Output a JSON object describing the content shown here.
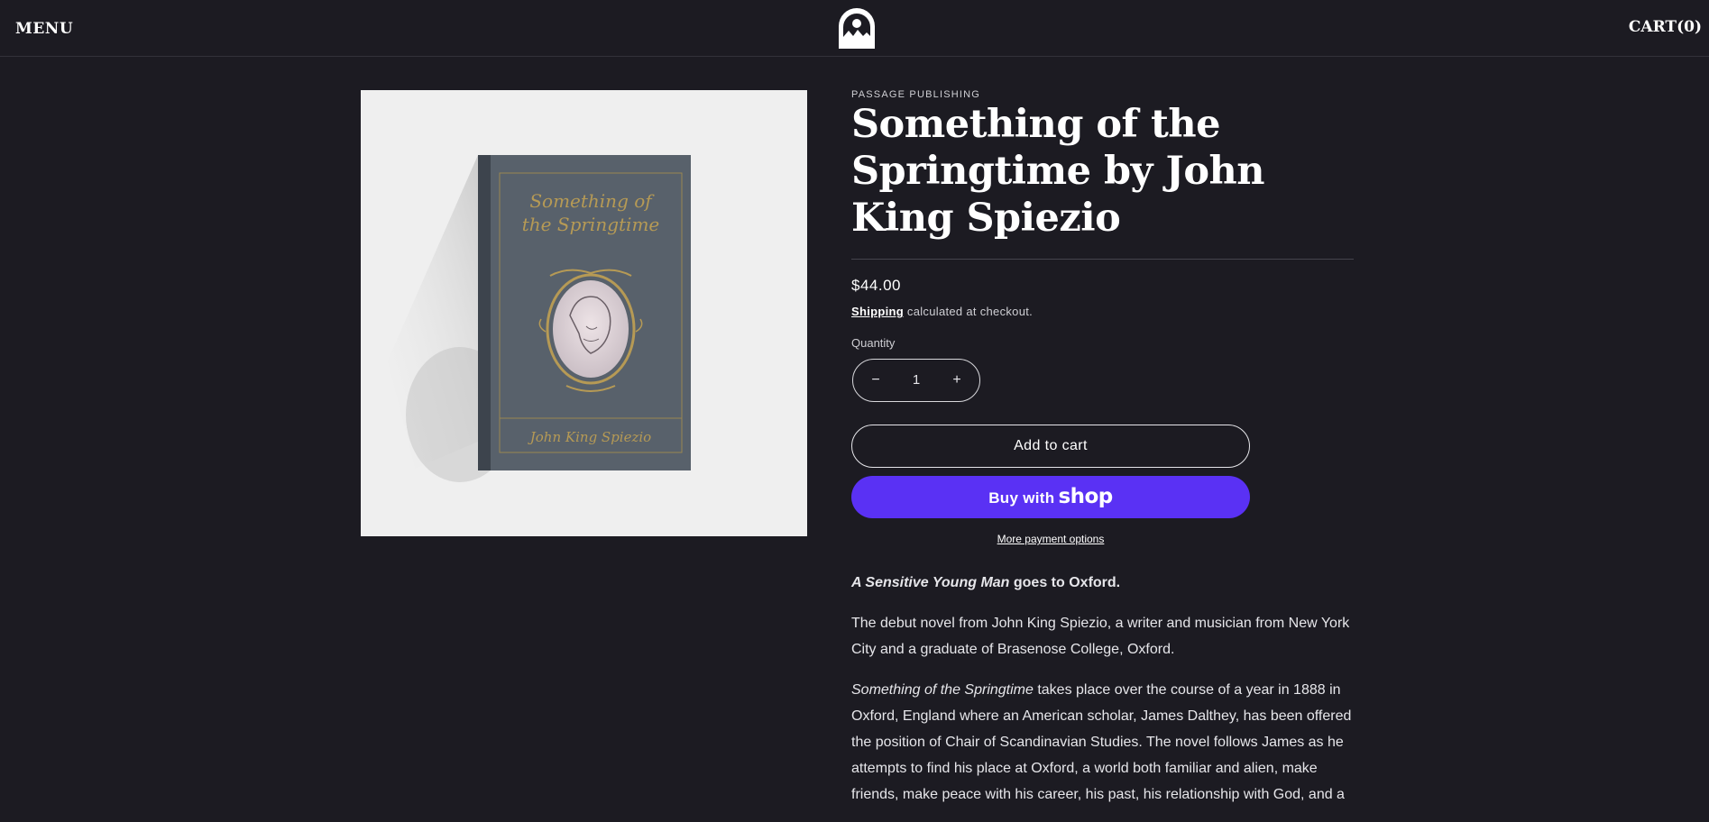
{
  "header": {
    "menu_label": "MENU",
    "cart_label": "CART(0)",
    "logo_icon": "arch-mountain-logo-icon"
  },
  "product": {
    "image_alt": "book-cover-image",
    "vendor": "PASSAGE PUBLISHING",
    "title": "Something of the Springtime by John King Spiezio",
    "price": "$44.00",
    "shipping_link": "Shipping",
    "shipping_text": " calculated at checkout.",
    "quantity_label": "Quantity",
    "quantity_value": "1",
    "minus_icon": "minus-icon",
    "plus_icon": "plus-icon",
    "add_to_cart": "Add to cart",
    "buy_with": "Buy with",
    "shop_word": "shop",
    "more_payment": "More payment options"
  },
  "book_cover": {
    "title_line1": "Something of",
    "title_line2": "the Springtime",
    "author": "John King Spiezio"
  },
  "description": {
    "lead_italic": "A Sensitive Young Man",
    "lead_rest": " goes to Oxford.",
    "p1": "The debut novel from John King Spiezio, a writer and musician from New York City and a graduate of Brasenose College, Oxford.",
    "p2_italic": "Something of the Springtime",
    "p2_rest": " takes place over the course of a year in 1888 in Oxford, England where an American scholar, James Dalthey, has been offered the position of Chair of Scandinavian Studies. The novel follows James as he attempts to find his place at Oxford, a world both familiar and alien, make friends, make peace with his career, his past, his relationship with God, and a"
  },
  "colors": {
    "background": "#1c1b22",
    "shop_purple": "#5a31f4",
    "cover_slate": "#58616b",
    "cover_gold": "#b69a55"
  }
}
